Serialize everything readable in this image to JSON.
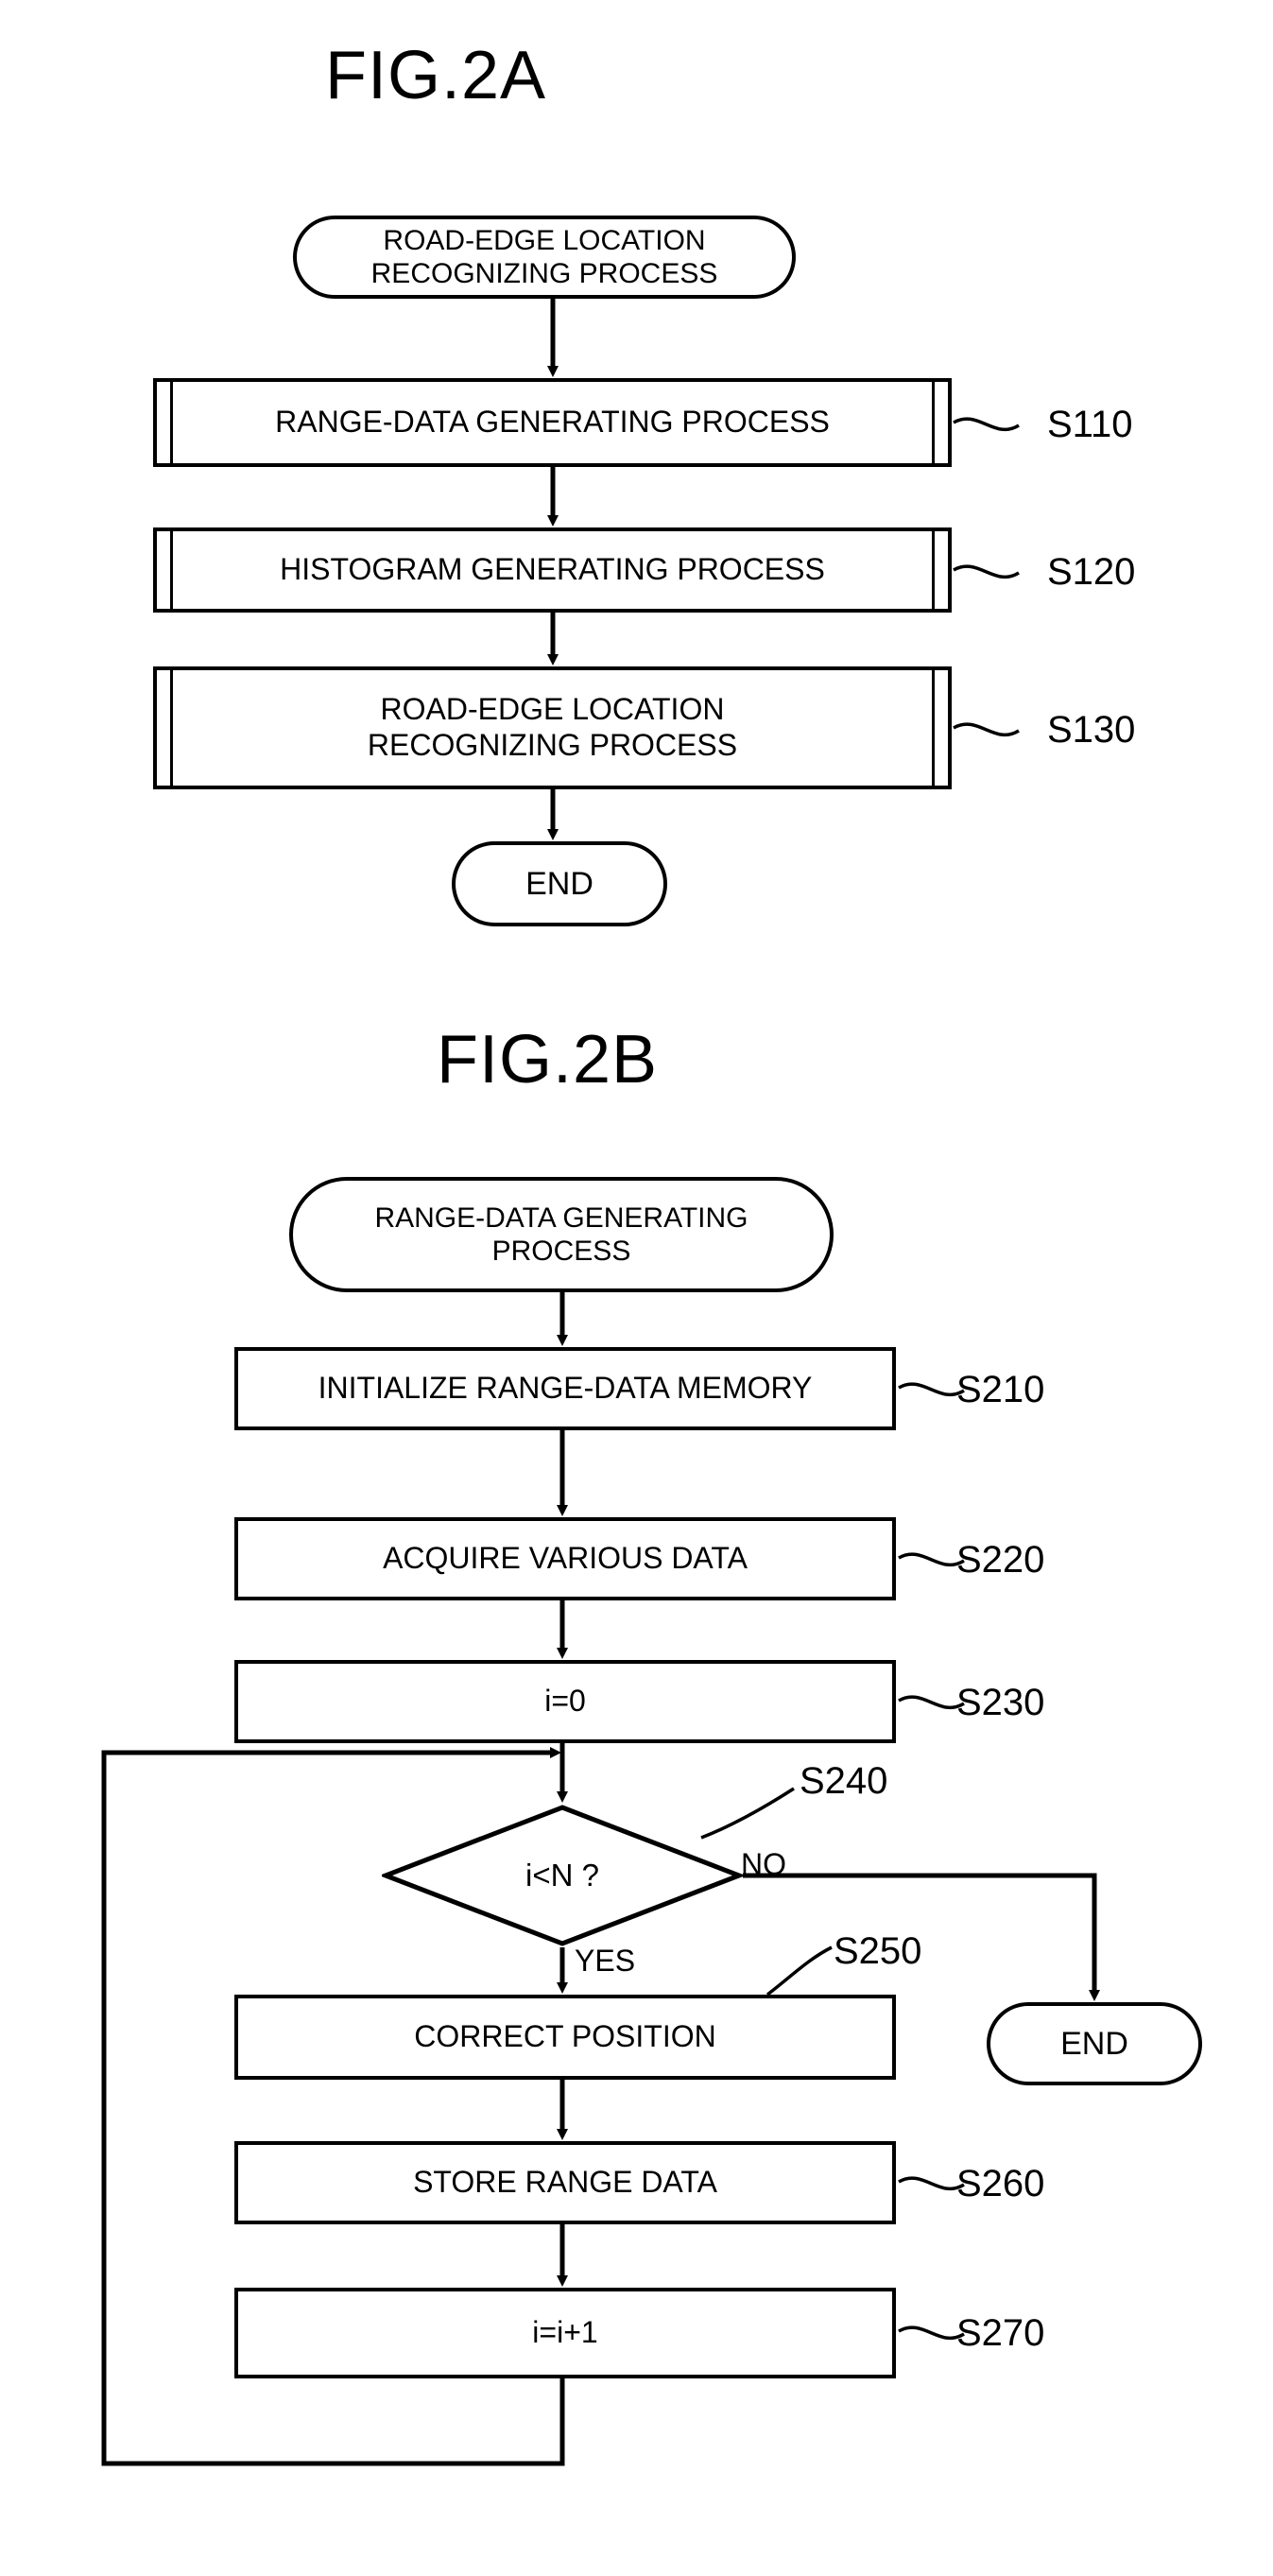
{
  "figures": [
    {
      "id": "fig-2a",
      "title": "FIG.2A",
      "start": {
        "label": "ROAD-EDGE LOCATION\nRECOGNIZING PROCESS"
      },
      "steps": [
        {
          "label": "RANGE-DATA GENERATING PROCESS",
          "ref": "S110",
          "type": "predefined-process"
        },
        {
          "label": "HISTOGRAM GENERATING PROCESS",
          "ref": "S120",
          "type": "predefined-process"
        },
        {
          "label": "ROAD-EDGE LOCATION\nRECOGNIZING PROCESS",
          "ref": "S130",
          "type": "predefined-process"
        }
      ],
      "end": {
        "label": "END"
      }
    },
    {
      "id": "fig-2b",
      "title": "FIG.2B",
      "start": {
        "label": "RANGE-DATA GENERATING\nPROCESS"
      },
      "steps": [
        {
          "label": "INITIALIZE RANGE-DATA MEMORY",
          "ref": "S210",
          "type": "process"
        },
        {
          "label": "ACQUIRE VARIOUS DATA",
          "ref": "S220",
          "type": "process"
        },
        {
          "label": "i=0",
          "ref": "S230",
          "type": "process"
        },
        {
          "label": "i<N ?",
          "ref": "S240",
          "type": "decision"
        },
        {
          "label": "CORRECT POSITION",
          "ref": "S250",
          "type": "process"
        },
        {
          "label": "STORE RANGE DATA",
          "ref": "S260",
          "type": "process"
        },
        {
          "label": "i=i+1",
          "ref": "S270",
          "type": "process"
        }
      ],
      "branches": {
        "yes": "YES",
        "no": "NO"
      },
      "end": {
        "label": "END"
      }
    }
  ],
  "colors": {
    "ink": "#000000",
    "paper": "#ffffff"
  }
}
